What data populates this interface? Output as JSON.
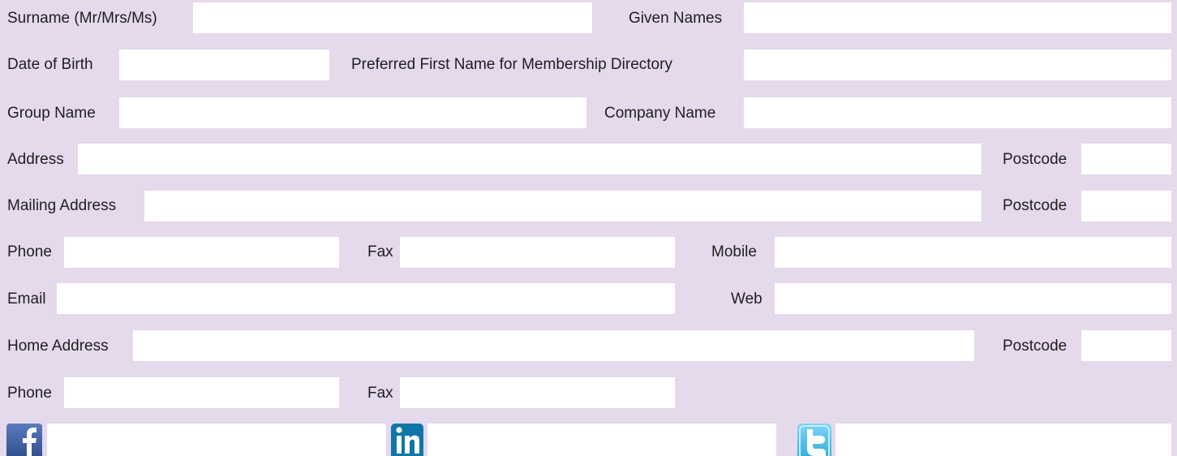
{
  "form": {
    "labels": {
      "surname": "Surname (Mr/Mrs/Ms)",
      "given_names": "Given Names",
      "date_of_birth": "Date of Birth",
      "preferred_first_name": "Preferred First Name for Membership Directory",
      "group_name": "Group Name",
      "company_name": "Company Name",
      "address": "Address",
      "address_postcode": "Postcode",
      "mailing_address": "Mailing Address",
      "mailing_postcode": "Postcode",
      "phone": "Phone",
      "fax": "Fax",
      "mobile": "Mobile",
      "email": "Email",
      "web": "Web",
      "home_address": "Home Address",
      "home_postcode": "Postcode",
      "home_phone": "Phone",
      "home_fax": "Fax"
    },
    "values": {
      "surname": "",
      "given_names": "",
      "date_of_birth": "",
      "preferred_first_name": "",
      "group_name": "",
      "company_name": "",
      "address": "",
      "address_postcode": "",
      "mailing_address": "",
      "mailing_postcode": "",
      "phone": "",
      "fax": "",
      "mobile": "",
      "email": "",
      "web": "",
      "home_address": "",
      "home_postcode": "",
      "home_phone": "",
      "home_fax": "",
      "facebook": "",
      "linkedin": "",
      "twitter": ""
    },
    "social": {
      "facebook": {
        "icon": "facebook-icon",
        "glyph": "f",
        "color": "#3b5998"
      },
      "linkedin": {
        "icon": "linkedin-icon",
        "glyph": "in",
        "color": "#0e76a8"
      },
      "twitter": {
        "icon": "twitter-icon",
        "glyph": "t",
        "color": "#3fb7e5"
      }
    }
  },
  "colors": {
    "background": "#e5d9ec",
    "field": "#ffffff",
    "text": "#1e1e1e"
  }
}
